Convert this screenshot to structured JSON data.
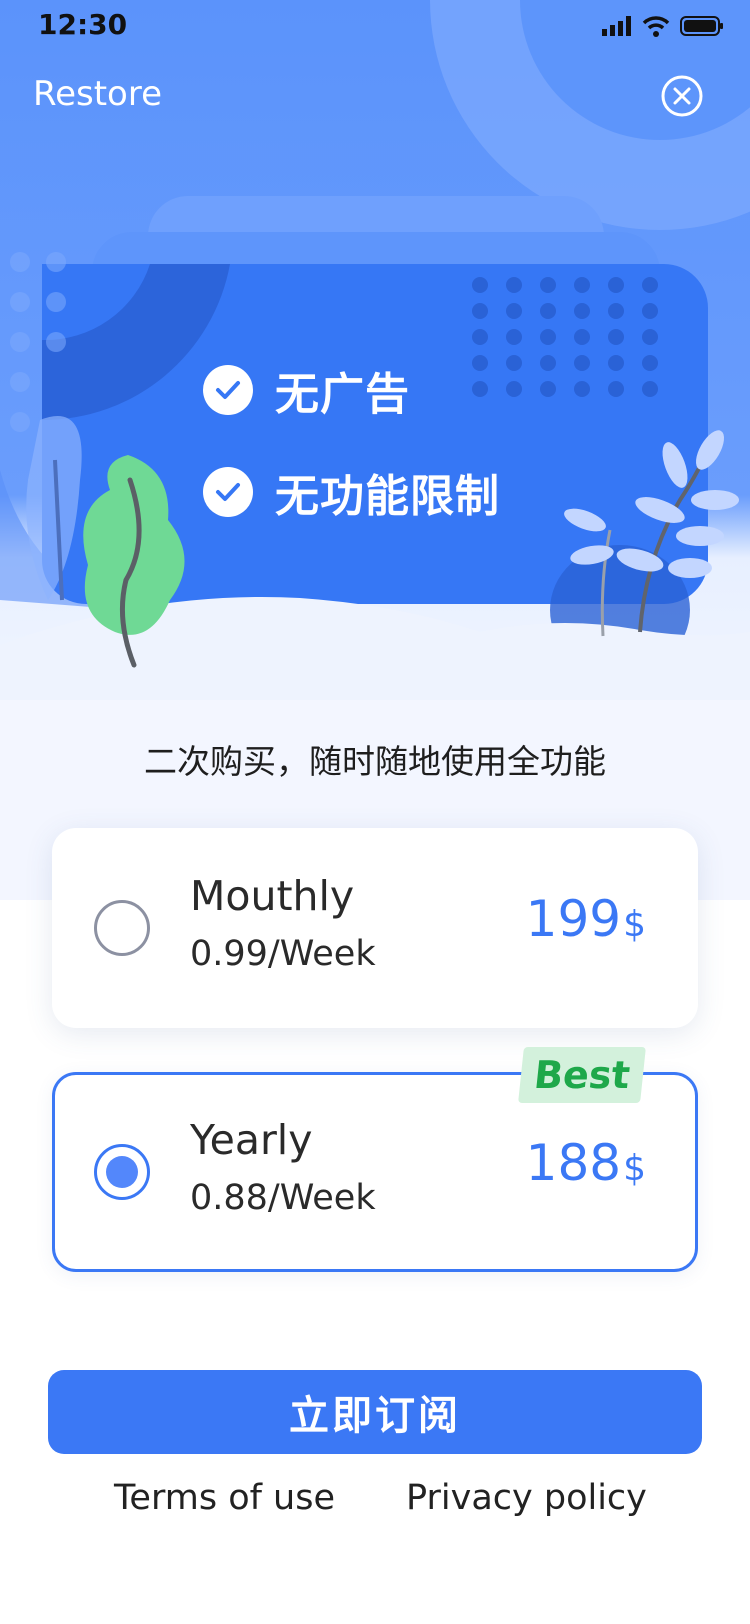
{
  "status_bar": {
    "time": "12:30"
  },
  "header": {
    "restore_label": "Restore"
  },
  "features": [
    {
      "label": "无广告"
    },
    {
      "label": "无功能限制"
    }
  ],
  "tagline": "二次购买，随时随地使用全功能",
  "plans": [
    {
      "name": "Mouthly",
      "rate": "0.99/Week",
      "price": "199",
      "currency": "$",
      "selected": false
    },
    {
      "name": "Yearly",
      "rate": "0.88/Week",
      "price": "188",
      "currency": "$",
      "selected": true,
      "badge": "Best"
    }
  ],
  "subscribe_label": "立即订阅",
  "footer": {
    "terms_label": "Terms of use",
    "privacy_label": "Privacy policy"
  },
  "colors": {
    "primary": "#3b78f5",
    "hero": "#5b93fb",
    "card_blue": "#3677f5",
    "leaf_green": "#6fd995",
    "badge_bg": "#d3f1dc",
    "badge_text": "#1ea84a"
  }
}
